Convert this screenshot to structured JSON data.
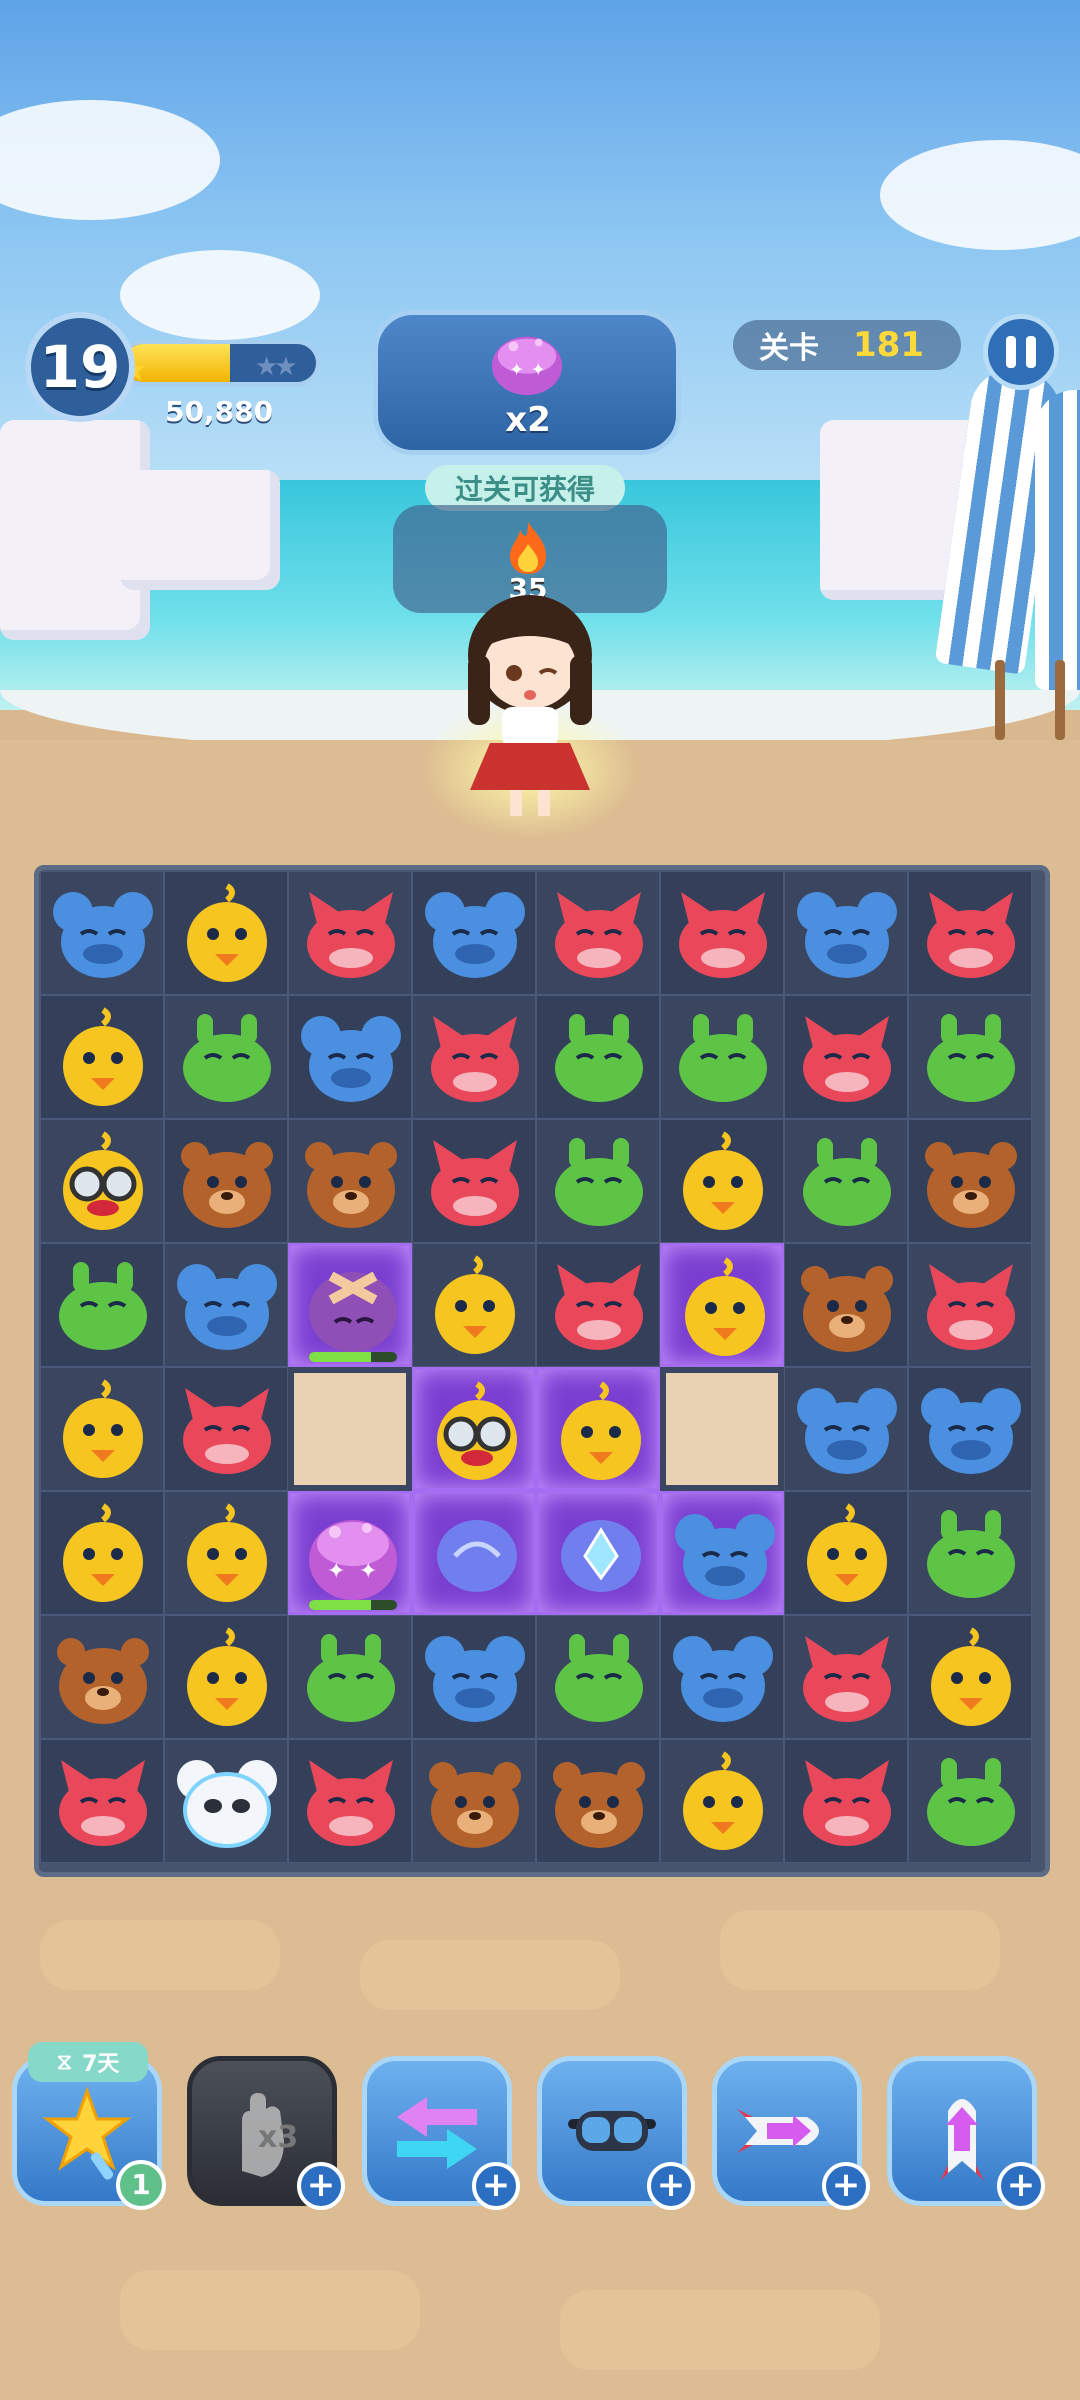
{
  "hud": {
    "player_level": "19",
    "xp_fraction": 0.55,
    "score": "50,880",
    "goal": {
      "target_icon": "pink-mushroom-monster-icon",
      "count": "x2"
    },
    "reward": {
      "label": "过关可获得",
      "icon": "fire-icon",
      "count": "35"
    },
    "level": {
      "label": "关卡",
      "number": "181"
    }
  },
  "colors": {
    "mouse": "#4a8fe0",
    "duck": "#f6c520",
    "fox": "#e8485a",
    "frog": "#5ec446",
    "bear": "#b4622c",
    "board": "#46546d"
  },
  "board": {
    "cols": 8,
    "rows": 8,
    "cells": [
      [
        "mouse",
        "duck",
        "fox",
        "mouse",
        "fox",
        "fox",
        "mouse",
        "fox"
      ],
      [
        "duck",
        "frog",
        "mouse",
        "fox",
        "frog",
        "frog",
        "fox",
        "frog"
      ],
      [
        "duck-goggles",
        "bear",
        "bear",
        "fox",
        "frog",
        "duck",
        "frog",
        "bear"
      ],
      [
        "frog",
        "mouse",
        "purple-monster-bandaged",
        "duck",
        "fox",
        "duck-purple",
        "bear",
        "fox"
      ],
      [
        "duck",
        "fox",
        "empty",
        "duck-goggles-purple",
        "duck-purple",
        "empty",
        "mouse",
        "mouse"
      ],
      [
        "duck",
        "duck",
        "pink-mushroom-monster",
        "swirl-purple",
        "blue-gem-purple",
        "mouse-purple",
        "duck",
        "frog"
      ],
      [
        "bear",
        "duck",
        "frog",
        "mouse",
        "frog",
        "mouse",
        "fox",
        "duck"
      ],
      [
        "fox",
        "white-mouse",
        "fox",
        "bear",
        "bear",
        "duck",
        "fox",
        "frog"
      ]
    ],
    "monster_health": 0.7
  },
  "boosters": [
    {
      "name": "star-wand",
      "timer_icon": "hourglass-icon",
      "timer": "7天",
      "count": "1"
    },
    {
      "name": "glove-x3",
      "count": "+"
    },
    {
      "name": "swap-arrows",
      "count": "+"
    },
    {
      "name": "goggles",
      "count": "+"
    },
    {
      "name": "horizontal-rocket",
      "count": "+"
    },
    {
      "name": "vertical-rocket",
      "count": "+"
    }
  ]
}
